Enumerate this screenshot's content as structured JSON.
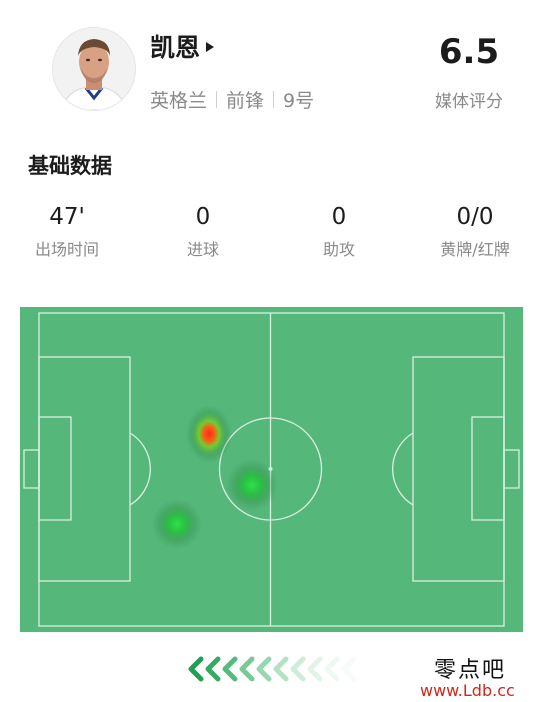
{
  "player": {
    "name": "凯恩",
    "team": "英格兰",
    "position": "前锋",
    "number": "9号"
  },
  "rating": {
    "value": "6.5",
    "label": "媒体评分"
  },
  "section": {
    "title": "基础数据"
  },
  "stats": [
    {
      "value": "47'",
      "label": "出场时间"
    },
    {
      "value": "0",
      "label": "进球"
    },
    {
      "value": "0",
      "label": "助攻"
    },
    {
      "value": "0/0",
      "label": "黄牌/红牌"
    }
  ],
  "heatmap": {
    "pitch_color": "#55b77a",
    "line_color": "#d9f0df",
    "hot_color": "#ff2a1a",
    "warm_color": "#22c23a"
  },
  "watermark": {
    "text": "零点吧",
    "url": "www.Ldb.cc"
  },
  "icons": {
    "player_link": "play-triangle-icon",
    "pager": "chevron-left-arrows-icon"
  }
}
